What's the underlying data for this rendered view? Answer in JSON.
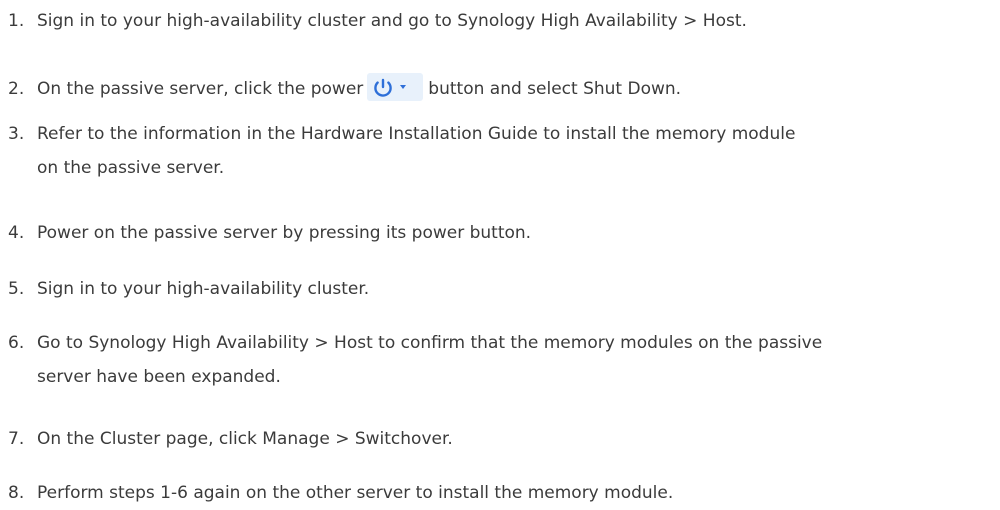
{
  "steps": [
    {
      "number": "1.",
      "text": "Sign in to your high-availability cluster and go to Synology High Availability > Host."
    },
    {
      "number": "2.",
      "before": "On the passive server, click the power",
      "icon": "power-icon",
      "after": "button and select Shut Down."
    },
    {
      "number": "3.",
      "line1": "Refer to the information in the Hardware Installation Guide to install the memory module",
      "line2": "on the passive server."
    },
    {
      "number": "4.",
      "text": "Power on the passive server by pressing its power button."
    },
    {
      "number": "5.",
      "text": "Sign in to your high-availability cluster."
    },
    {
      "number": "6.",
      "line1": "Go to Synology High Availability > Host to confirm that the memory modules on the passive",
      "line2": "server have been expanded."
    },
    {
      "number": "7.",
      "text": "On the Cluster page, click Manage > Switchover."
    },
    {
      "number": "8.",
      "text": "Perform steps 1-6 again on the other server to install the memory module."
    }
  ],
  "colors": {
    "text": "#3b3b3b",
    "icon_bg": "#e8f1fb",
    "icon_fg": "#2e6fd8"
  }
}
